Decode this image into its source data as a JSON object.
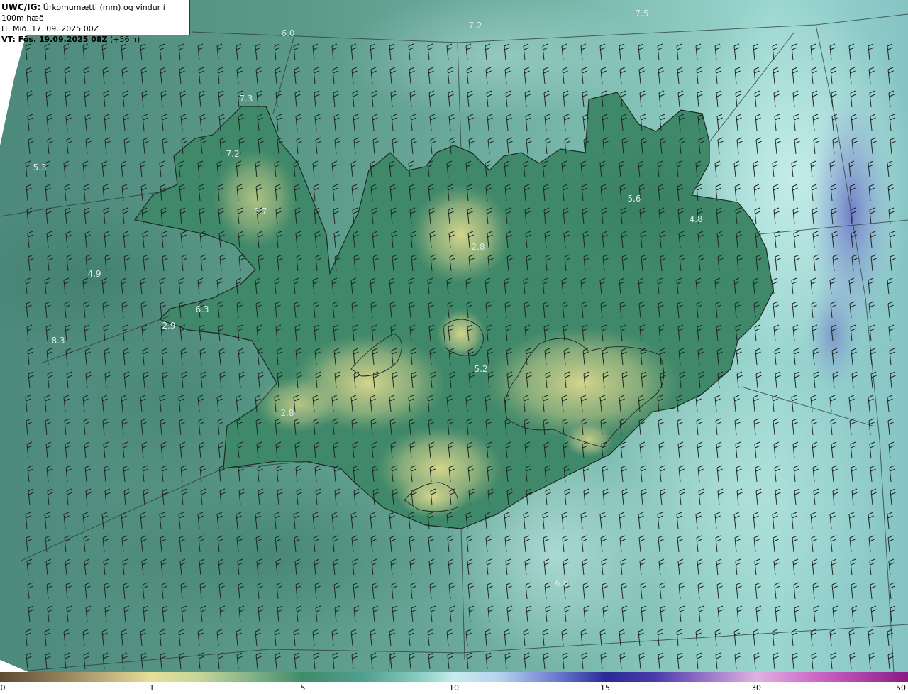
{
  "header": {
    "model_label": "UWC/IG:",
    "product": "Úrkomumætti (mm) og vindur í 100m hæð",
    "init_time": "IT: Mið. 17. 09. 2025 00Z",
    "valid_label": "VT: Fös. 19.09.2025 08Z",
    "lead": "(+56 h)"
  },
  "colorbar": {
    "ticks": [
      "0",
      "1",
      "5",
      "10",
      "15",
      "30",
      "50"
    ]
  },
  "map_values": [
    "7.5",
    "7.2",
    "6.0",
    "7.3",
    "7.2",
    "5.3",
    "3.7",
    "5.6",
    "4.8",
    "2.8",
    "4.9",
    "6.3",
    "2.9",
    "8.3",
    "5.2",
    "2.8",
    "6.8"
  ],
  "colors": {
    "sea": "#5f9c8c",
    "sea_light": "#a6ddd8",
    "land_low": "#3d8468",
    "land_high": "#d6d48c",
    "heavy": "#6b76c8"
  }
}
